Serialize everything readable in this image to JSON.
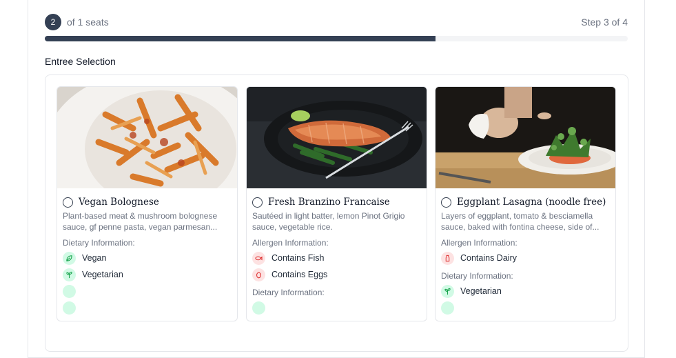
{
  "progress": {
    "seat_number": "2",
    "seat_text": "of 1 seats",
    "step_text": "Step 3 of 4",
    "fraction": 0.67
  },
  "section": {
    "title": "Entree Selection"
  },
  "cards": [
    {
      "title": "Vegan Bolognese",
      "description": "Plant-based meat & mushroom bolognese sauce, gf penne pasta, vegan parmesan...",
      "dietary_label": "Dietary Information:",
      "dietary": [
        {
          "icon": "leaf-icon",
          "label": "Vegan"
        },
        {
          "icon": "sprout-icon",
          "label": "Vegetarian"
        },
        {
          "icon": "blank-icon",
          "label": ""
        },
        {
          "icon": "blank-icon",
          "label": ""
        }
      ]
    },
    {
      "title": "Fresh Branzino Francaise",
      "description": "Sautéed in light batter, lemon Pinot Grigio sauce, vegetable rice.",
      "allergen_label": "Allergen Information:",
      "allergens": [
        {
          "icon": "fish-icon",
          "label": "Contains Fish"
        },
        {
          "icon": "egg-icon",
          "label": "Contains Eggs"
        }
      ],
      "dietary_label": "Dietary Information:",
      "dietary": [
        {
          "icon": "blank-icon",
          "label": ""
        }
      ]
    },
    {
      "title": "Eggplant Lasagna (noodle free)",
      "description": "Layers of eggplant, tomato & besciamella sauce, baked with fontina cheese, side of...",
      "allergen_label": "Allergen Information:",
      "allergens": [
        {
          "icon": "milk-icon",
          "label": "Contains Dairy"
        }
      ],
      "dietary_label": "Dietary Information:",
      "dietary": [
        {
          "icon": "sprout-icon",
          "label": "Vegetarian"
        },
        {
          "icon": "blank-icon",
          "label": ""
        }
      ]
    }
  ],
  "colors": {
    "accent": "#344054",
    "green_bg": "#d1fae5",
    "green_fg": "#16a34a",
    "red_bg": "#fde2e2",
    "red_fg": "#dc2626"
  }
}
